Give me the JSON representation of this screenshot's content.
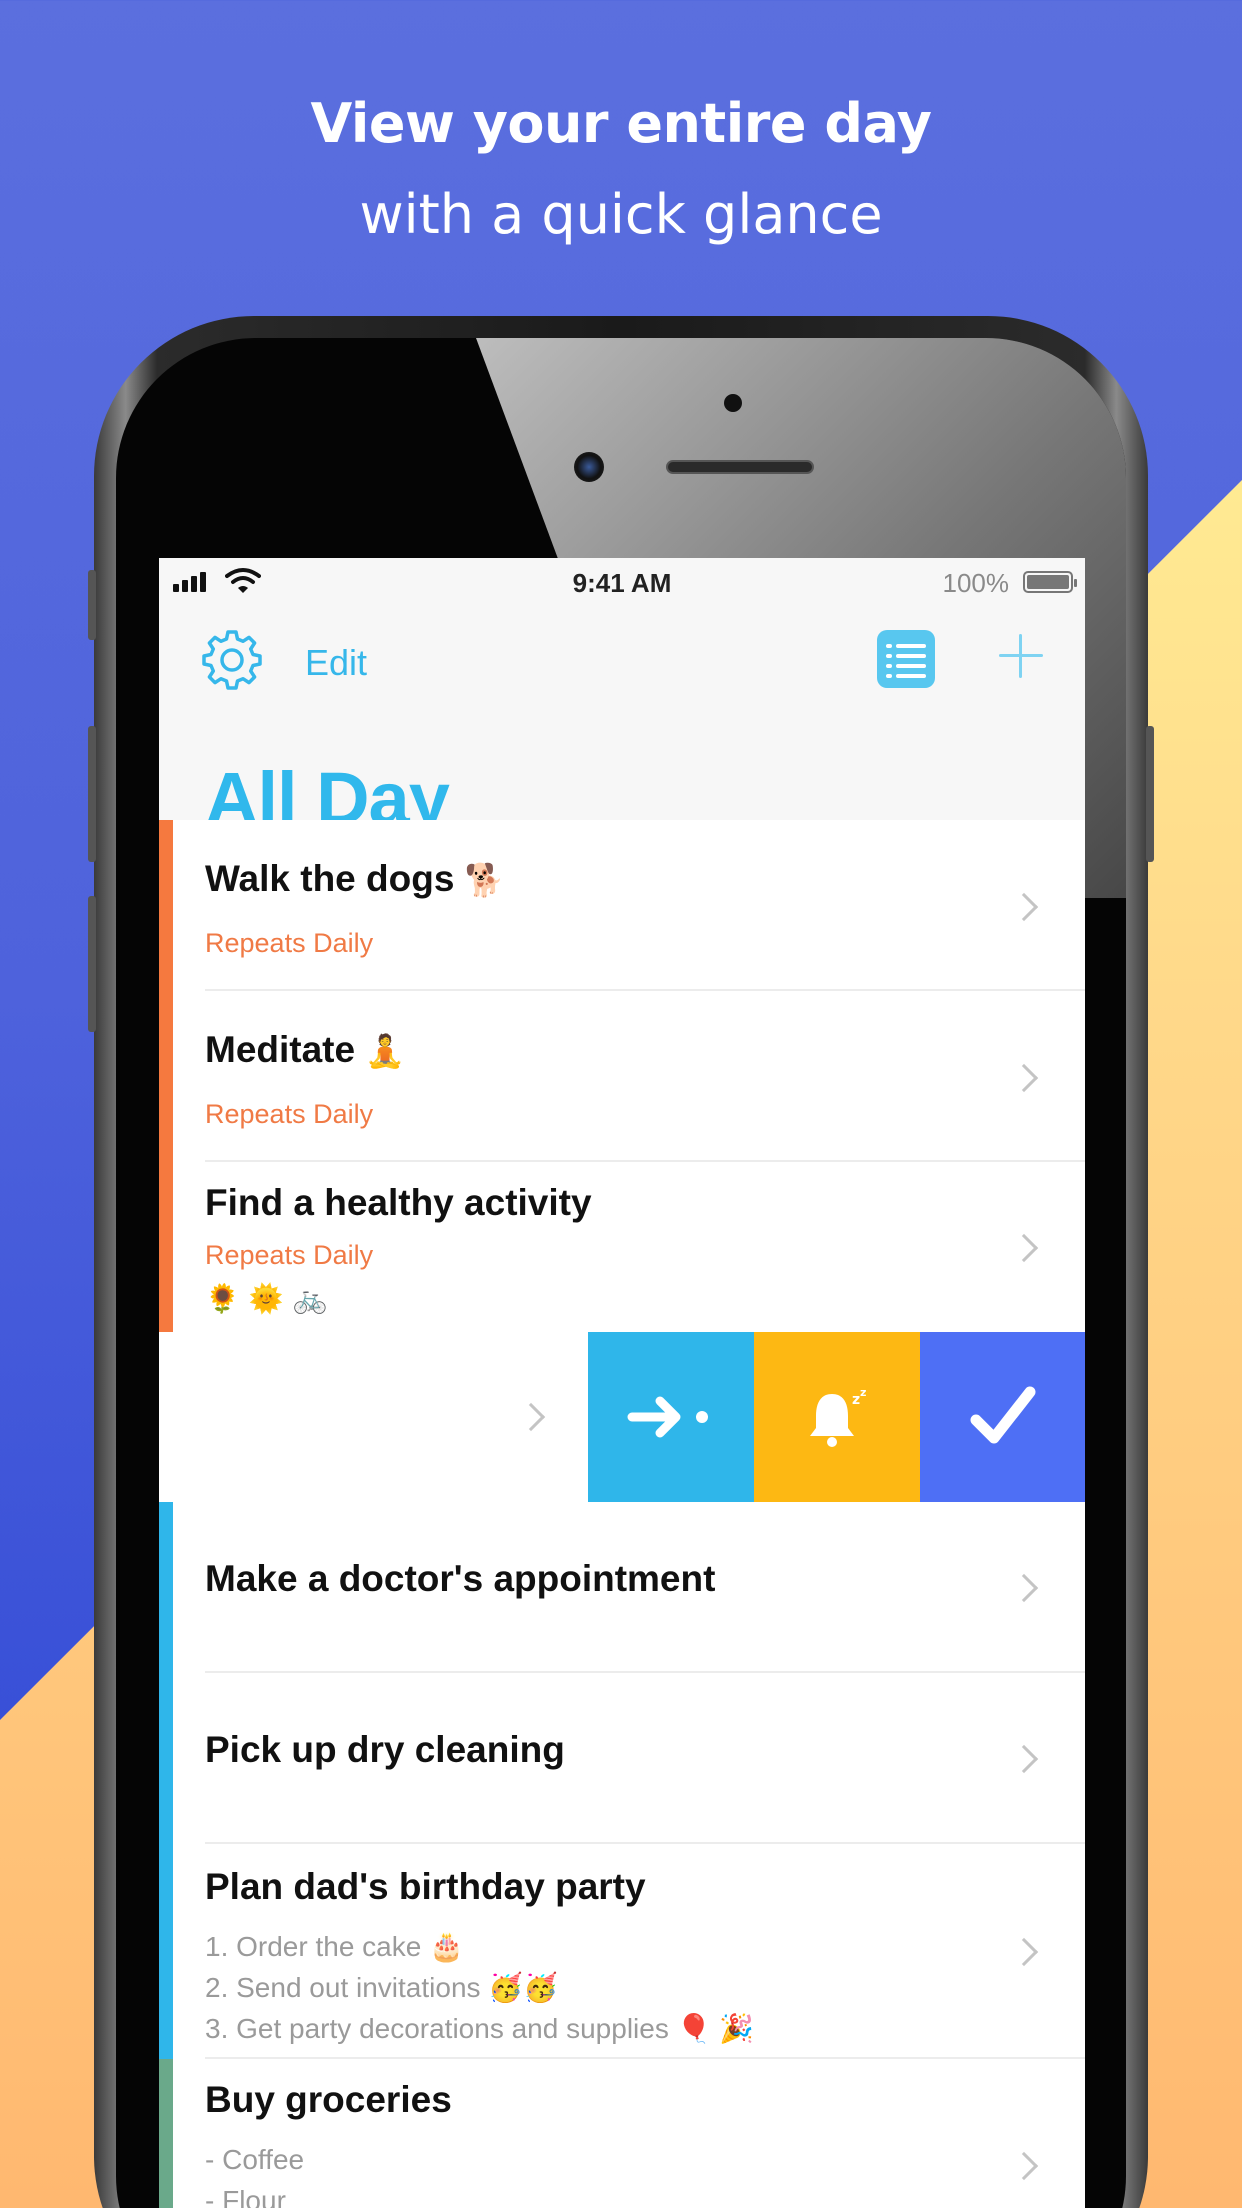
{
  "headline": {
    "line1": "View your entire day",
    "line2": "with a quick glance"
  },
  "status_bar": {
    "time": "9:41 AM",
    "battery_percent": "100%",
    "battery_level": 1.0
  },
  "header": {
    "settings_icon": "gear-icon",
    "edit_label": "Edit",
    "list_view_icon": "list-icon",
    "add_icon": "plus-icon",
    "title": "All Day"
  },
  "colors": {
    "accent": "#30b8ec",
    "daily_bar": "#f5793f",
    "repeat_text": "#f07a45",
    "blue_bar": "#2fb6ea",
    "green_bar": "#6aa98a",
    "action_move": "#2fb6ea",
    "action_snooze": "#fdb813",
    "action_done": "#4e6ff5"
  },
  "tasks": [
    {
      "title": "Walk the dogs",
      "emoji": "🐕",
      "subtitle": "Repeats Daily"
    },
    {
      "title": "Meditate",
      "emoji": "🧘",
      "subtitle": "Repeats Daily"
    },
    {
      "title": "Find a healthy activity",
      "subtitle": "Repeats Daily",
      "emojis": "🌻 🌞 🚲"
    },
    {
      "title": "Make a doctor's appointment"
    },
    {
      "title": "Pick up dry cleaning"
    },
    {
      "title": "Plan dad's birthday party",
      "notes": [
        "1. Order the cake 🎂",
        "2. Send out invitations 🥳🥳",
        "3. Get party decorations and supplies 🎈 🎉"
      ]
    },
    {
      "title": "Buy groceries",
      "notes": [
        "- Coffee",
        "- Flour"
      ]
    }
  ],
  "swipe_actions": [
    {
      "name": "move-to-later",
      "icon": "arrow-right-dot-icon"
    },
    {
      "name": "snooze",
      "icon": "bell-snooze-icon"
    },
    {
      "name": "complete",
      "icon": "checkmark-icon"
    }
  ]
}
